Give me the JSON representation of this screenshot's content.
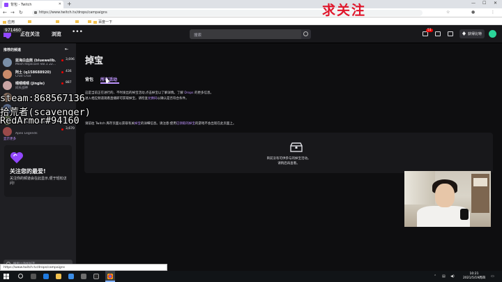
{
  "browser": {
    "tab_title": "背包 - Twitch",
    "url": "https://www.twitch.tv/drops/campaigns",
    "bookmarks": [
      "应用",
      "",
      "",
      "",
      "",
      "百度一下"
    ],
    "status_url": "https://www.twitch.tv/drops/campaigns"
  },
  "overlay": {
    "follow_banner": "求关注",
    "uid": "971460",
    "line1": "steam:868567136",
    "line2": "拾荒者(scavenger)",
    "line3": "RedArmor#94160"
  },
  "topnav": {
    "following": "正在关注",
    "browse": "浏览",
    "search_placeholder": "搜索",
    "notification_count": "51",
    "get_bits": "获得比特"
  },
  "sidebar": {
    "header": "推荐的频道",
    "channels": [
      {
        "name": "蓝海白血熊 (bluewellb...",
        "game": "Mesh Replicant Vol.1 22...",
        "viewers": "3,696",
        "color": "#7a8fa8"
      },
      {
        "name": "阿土 (q158688920)",
        "game": "Chat Chat",
        "viewers": "436",
        "color": "#c98a6a"
      },
      {
        "name": "晴晴晴晴 (jingle)",
        "game": "间天战神",
        "viewers": "887",
        "color": "#c9a4a4"
      },
      {
        "name": "",
        "game": "Secret",
        "viewers": "",
        "color": "#8a7060"
      },
      {
        "name": "",
        "game": "",
        "viewers": "",
        "color": "#5a6a8a"
      },
      {
        "name": "",
        "game": "Call of Duty: Warzone",
        "viewers": "",
        "color": "#6a7a5a"
      },
      {
        "name": "",
        "game": "Apex Legends",
        "viewers": "3,670",
        "color": "#9a4a4a"
      }
    ],
    "show_more": "显示更多",
    "promo_title": "关注您的最爱!",
    "promo_text": "关注你的频道会在此显示,便于轻松访问!",
    "search_placeholder": "搜索以添加好友"
  },
  "main": {
    "title": "掉宝",
    "tabs": [
      "背包",
      "所有活动"
    ],
    "info": [
      {
        "text": "这是当前正在进行的、不时发出的掉宝活动,点击掉宝以了解详情。了解 ",
        "link": "Drops",
        "after": " 的更多信息。"
      },
      {
        "text": "进入相应频道观看直播即可获取掉宝。请检查",
        "link": "兑换码",
        "after": "以确认是否符合条件。"
      },
      {
        "text": "",
        "link": "",
        "after": ""
      },
      {
        "text": "",
        "link": "",
        "after": ""
      },
      {
        "text": "请前往 Twitch 库存页面以获取有关",
        "link": "掉宝",
        "after": "的详细信息。请注意:使用",
        "link2": "已领取的掉宝",
        "after2": "的游戏不会出现在此页面上。"
      }
    ],
    "empty_line1": "目前没有可供参与的掉宝活动。",
    "empty_line2": "请稍后再查看。"
  },
  "taskbar": {
    "time": "10:21",
    "date": "2021/5/19周四"
  },
  "colors": {
    "accent": "#9147ff",
    "link": "#bf94ff",
    "live": "#eb0400"
  }
}
